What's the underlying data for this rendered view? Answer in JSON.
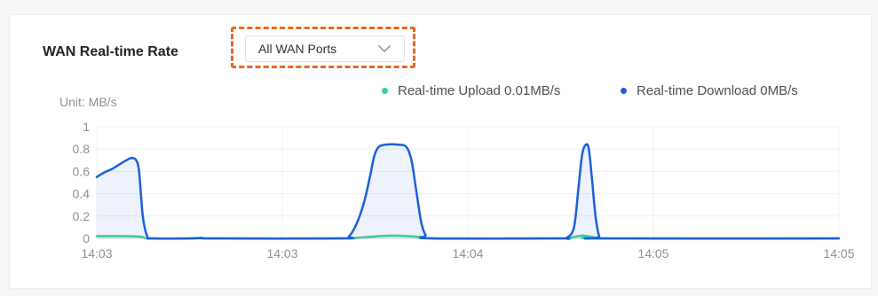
{
  "header": {
    "title": "WAN Real-time Rate",
    "port_select": {
      "value": "All WAN Ports"
    }
  },
  "colors": {
    "upload": "#3dcc8e",
    "download": "#1a5fd9",
    "highlight": "#e46a1e"
  },
  "chart_data": {
    "type": "line",
    "unit_label": "Unit: MB/s",
    "ylim": [
      0,
      1
    ],
    "yticks": [
      "0",
      "0.2",
      "0.4",
      "0.6",
      "0.8",
      "1"
    ],
    "xticks": [
      "14:03",
      "14:03",
      "14:04",
      "14:05",
      "14:05"
    ],
    "xrange": [
      0,
      100
    ],
    "grid": true,
    "legend_position": "top-right",
    "series": [
      {
        "name": "Real-time Upload",
        "legend_label": "Real-time Upload 0.01MB/s",
        "points": [
          [
            0,
            0.02
          ],
          [
            4,
            0.02
          ],
          [
            6,
            0.015
          ],
          [
            7,
            0.0
          ],
          [
            12,
            0.0
          ],
          [
            14,
            0.005
          ],
          [
            16,
            0.0
          ],
          [
            33,
            0.0
          ],
          [
            35,
            0.005
          ],
          [
            38,
            0.02
          ],
          [
            40,
            0.025
          ],
          [
            42,
            0.02
          ],
          [
            44,
            0.01
          ],
          [
            46,
            0.0
          ],
          [
            62,
            0.0
          ],
          [
            64,
            0.01
          ],
          [
            65.5,
            0.025
          ],
          [
            67,
            0.01
          ],
          [
            68,
            0.0
          ],
          [
            100,
            0.0
          ]
        ]
      },
      {
        "name": "Real-time Download",
        "legend_label": "Real-time Download 0MB/s",
        "points": [
          [
            0,
            0.55
          ],
          [
            1,
            0.59
          ],
          [
            2,
            0.62
          ],
          [
            3,
            0.66
          ],
          [
            4,
            0.7
          ],
          [
            4.7,
            0.72
          ],
          [
            5.3,
            0.7
          ],
          [
            5.7,
            0.6
          ],
          [
            6.2,
            0.2
          ],
          [
            6.8,
            0.02
          ],
          [
            7.5,
            0.0
          ],
          [
            13,
            0.0
          ],
          [
            14.2,
            0.005
          ],
          [
            15.5,
            0.0
          ],
          [
            33,
            0.0
          ],
          [
            34,
            0.02
          ],
          [
            35,
            0.13
          ],
          [
            36,
            0.32
          ],
          [
            36.8,
            0.55
          ],
          [
            37.4,
            0.74
          ],
          [
            38,
            0.82
          ],
          [
            39,
            0.84
          ],
          [
            40.5,
            0.84
          ],
          [
            41.7,
            0.82
          ],
          [
            42.4,
            0.7
          ],
          [
            43,
            0.45
          ],
          [
            43.7,
            0.15
          ],
          [
            44.3,
            0.03
          ],
          [
            45,
            0.0
          ],
          [
            62,
            0.0
          ],
          [
            63.3,
            0.005
          ],
          [
            64.3,
            0.1
          ],
          [
            64.9,
            0.45
          ],
          [
            65.4,
            0.75
          ],
          [
            65.9,
            0.84
          ],
          [
            66.3,
            0.8
          ],
          [
            66.7,
            0.55
          ],
          [
            67.2,
            0.2
          ],
          [
            67.7,
            0.02
          ],
          [
            68.3,
            0.0
          ],
          [
            100,
            0.0
          ]
        ]
      }
    ]
  }
}
